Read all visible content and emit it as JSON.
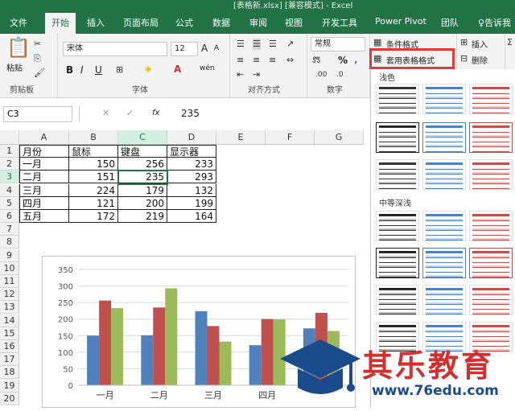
{
  "window": {
    "title": "[表格新.xlsx] [兼容模式] - Excel",
    "signin": ""
  },
  "tabs": [
    {
      "label": "文件",
      "active": false
    },
    {
      "label": "开始",
      "active": true
    },
    {
      "label": "插入",
      "active": false
    },
    {
      "label": "页面布局",
      "active": false
    },
    {
      "label": "公式",
      "active": false
    },
    {
      "label": "数据",
      "active": false
    },
    {
      "label": "审阅",
      "active": false
    },
    {
      "label": "视图",
      "active": false
    },
    {
      "label": "开发工具",
      "active": false
    },
    {
      "label": "Power Pivot",
      "active": false
    },
    {
      "label": "团队",
      "active": false
    },
    {
      "label": "告诉我",
      "active": false
    }
  ],
  "ribbon": {
    "clipboard": {
      "label": "剪贴板",
      "paste": "粘贴"
    },
    "font": {
      "label": "字体",
      "name": "宋体",
      "size": "12",
      "bold": "B",
      "italic": "I",
      "underline": "U",
      "grow": "A",
      "shrink": "A",
      "color_a": "A",
      "phonetic": "wén"
    },
    "align": {
      "label": "对齐方式"
    },
    "number": {
      "label": "数字",
      "format": "常规",
      "percent": "%",
      "comma": ","
    },
    "styles": {
      "conditional": "条件格式",
      "table_format": "套用表格格式"
    },
    "cells": {
      "insert": "插入",
      "delete": "删除"
    }
  },
  "formula_bar": {
    "cell_ref": "C3",
    "value": "235",
    "fx": "fx"
  },
  "grid": {
    "columns": [
      "A",
      "B",
      "C",
      "D",
      "E",
      "F",
      "G"
    ],
    "rows": [
      "1",
      "2",
      "3",
      "4",
      "5",
      "6",
      "7",
      "8",
      "9",
      "10",
      "11",
      "12",
      "13",
      "14",
      "15",
      "16",
      "17",
      "18",
      "19",
      "20"
    ],
    "header": [
      "月份",
      "鼠标",
      "键盘",
      "显示器"
    ],
    "data": [
      [
        "一月",
        "150",
        "256",
        "233"
      ],
      [
        "二月",
        "151",
        "235",
        "293"
      ],
      [
        "三月",
        "224",
        "179",
        "132"
      ],
      [
        "四月",
        "121",
        "200",
        "199"
      ],
      [
        "五月",
        "172",
        "219",
        "164"
      ]
    ]
  },
  "chart_data": {
    "type": "bar",
    "categories": [
      "一月",
      "二月",
      "三月",
      "四月",
      "五月"
    ],
    "series": [
      {
        "name": "鼠标",
        "values": [
          150,
          151,
          224,
          121,
          172
        ],
        "color": "#4f81bd"
      },
      {
        "name": "键盘",
        "values": [
          256,
          235,
          179,
          200,
          219
        ],
        "color": "#c0504d"
      },
      {
        "name": "显示器",
        "values": [
          233,
          293,
          132,
          199,
          164
        ],
        "color": "#9bbb59"
      }
    ],
    "ylim": [
      0,
      350
    ],
    "yticks": [
      0,
      50,
      100,
      150,
      200,
      250,
      300,
      350
    ],
    "visible_x_labels": [
      "一月",
      "二月",
      "三月",
      "四月"
    ],
    "legend": "bottom",
    "title": "",
    "xlabel": "",
    "ylabel": ""
  },
  "gallery": {
    "light_label": "浅色",
    "medium_label": "中等深浅"
  },
  "watermark": {
    "name": "其乐教育",
    "url": "www.76edu.com"
  },
  "colors": {
    "excel_green": "#217346",
    "highlight_red": "#e53935"
  }
}
